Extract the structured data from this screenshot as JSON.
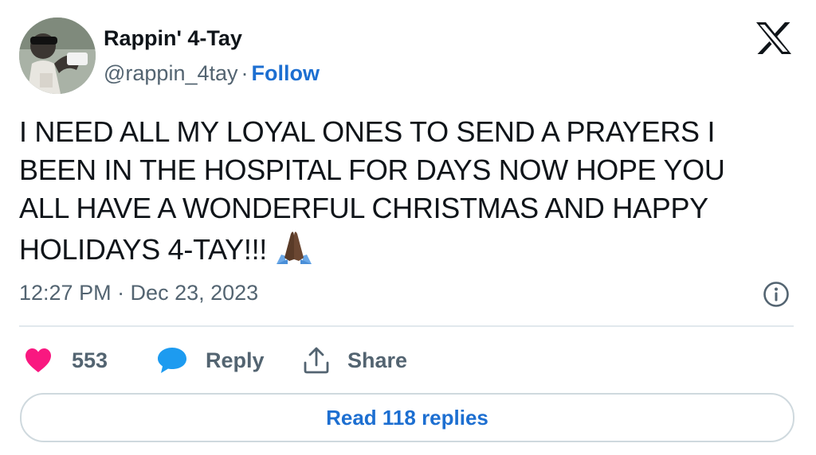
{
  "author": {
    "display_name": "Rappin' 4-Tay",
    "handle": "@rappin_4tay",
    "separator": "·",
    "follow_label": "Follow"
  },
  "tweet": {
    "lines": [
      "I NEED ALL MY LOYAL ONES TO SEND A PRAYERS I",
      "BEEN IN THE HOSPITAL FOR DAYS NOW HOPE YOU",
      "ALL HAVE A WONDERFUL CHRISTMAS AND HAPPY",
      "HOLIDAYS 4-TAY!!!"
    ],
    "emoji": "folded-hands-emoji"
  },
  "meta": {
    "timestamp": "12:27 PM · Dec 23, 2023"
  },
  "actions": {
    "like_count": "553",
    "reply_label": "Reply",
    "share_label": "Share"
  },
  "footer": {
    "read_replies_label": "Read 118 replies"
  },
  "colors": {
    "heart": "#f91880",
    "reply_bubble": "#1d9bf0",
    "link": "#1d6fd1",
    "muted": "#536471"
  },
  "icons": {
    "brand": "x-logo-icon",
    "info": "info-icon",
    "like": "heart-icon",
    "reply": "speech-bubble-icon",
    "share": "share-upload-icon"
  }
}
